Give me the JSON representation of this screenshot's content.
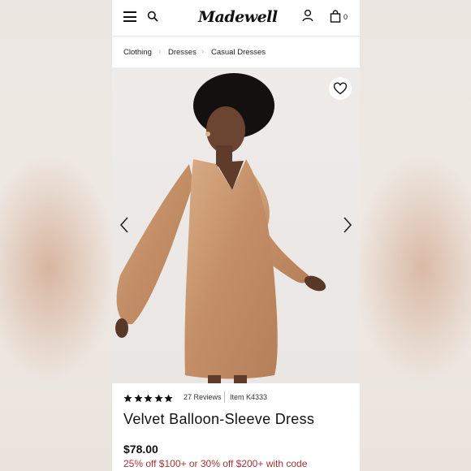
{
  "brand": {
    "logo_text": "Madewell"
  },
  "header": {
    "menu_icon": "hamburger-menu-icon",
    "search_icon": "search-icon",
    "account_icon": "user-icon",
    "bag_icon": "shopping-bag-icon",
    "bag_count": "0"
  },
  "breadcrumb": {
    "items": [
      "Clothing",
      "Dresses",
      "Casual Dresses"
    ]
  },
  "gallery": {
    "favorite_icon": "heart-icon",
    "prev_icon": "chevron-left-icon",
    "next_icon": "chevron-right-icon"
  },
  "product": {
    "rating_stars": 5,
    "reviews": "27 Reviews",
    "item_number": "Item K4333",
    "name": "Velvet Balloon-Sleeve Dress",
    "price": "$78.00",
    "promo": "25% off $100+ or 30% off $200+ with code"
  },
  "colors": {
    "accent_promo": "#a23536",
    "dress": "#c99770"
  }
}
